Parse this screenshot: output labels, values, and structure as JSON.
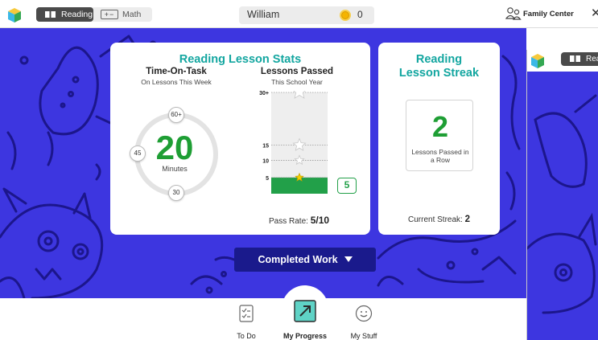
{
  "header": {
    "subjects": [
      {
        "label": "Reading",
        "selected": true
      },
      {
        "label": "Math",
        "selected": false
      }
    ],
    "student_name": "William",
    "coin_count": "0",
    "family_center_label": "Family Center"
  },
  "stats_card": {
    "title": "Reading Lesson Stats",
    "time_on_task": {
      "title": "Time-On-Task",
      "subtitle": "On Lessons This Week",
      "value": "20",
      "unit": "Minutes",
      "dial_labels": {
        "top": "60+",
        "left": "45",
        "bottom": "30"
      }
    },
    "lessons_passed": {
      "title": "Lessons Passed",
      "subtitle": "This School Year",
      "tick_labels": [
        "30+",
        "15",
        "10",
        "5"
      ],
      "value": "5",
      "pass_rate_label": "Pass Rate:",
      "pass_rate_value": "5/10"
    }
  },
  "chart_data": {
    "type": "bar",
    "title": "Lessons Passed",
    "categories": [
      "This School Year"
    ],
    "values": [
      5
    ],
    "y_ticks": [
      5,
      10,
      15,
      30
    ],
    "y_tick_labels": [
      "5",
      "10",
      "15",
      "30+"
    ],
    "ylim": [
      0,
      30
    ],
    "milestone_stars": [
      5,
      10,
      15,
      30
    ],
    "achieved_stars": [
      5
    ],
    "colors": {
      "bar": "#22a049",
      "background": "#eeeeee",
      "star_achieved": "#f4d000"
    }
  },
  "streak_card": {
    "title": "Reading Lesson Streak",
    "value": "2",
    "description": "Lessons Passed in a Row",
    "current_label": "Current Streak:",
    "current_value": "2"
  },
  "completed_work_label": "Completed Work",
  "bottom_nav": {
    "todo_label": "To Do",
    "progress_label": "My Progress",
    "stuff_label": "My Stuff"
  },
  "preview": {
    "subject_label": "Rea"
  },
  "theme": {
    "background": "#3d36e0",
    "accent_teal": "#13a6a0",
    "accent_green": "#1e9e34",
    "button_navy": "#1a1a8c"
  }
}
